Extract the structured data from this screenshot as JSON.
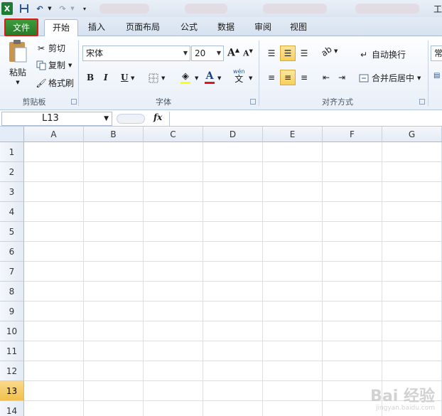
{
  "title": {
    "text": "工"
  },
  "tabs": {
    "file": "文件",
    "items": [
      "开始",
      "插入",
      "页面布局",
      "公式",
      "数据",
      "审阅",
      "视图"
    ]
  },
  "clipboard": {
    "paste": "粘贴",
    "cut": "剪切",
    "copy": "复制",
    "format_painter": "格式刷",
    "label": "剪贴板"
  },
  "font": {
    "name": "宋体",
    "size": "20",
    "bold": "B",
    "italic": "I",
    "underline": "U",
    "font_color_glyph": "A",
    "phonetic": "wén",
    "phonetic_char": "文",
    "label": "字体"
  },
  "alignment": {
    "wrap_text": "自动换行",
    "merge_center": "合并后居中",
    "label": "对齐方式"
  },
  "number": {
    "format_partial": "常"
  },
  "formula_bar": {
    "name_box": "L13",
    "fx": "fx",
    "value": ""
  },
  "grid": {
    "columns": [
      "A",
      "B",
      "C",
      "D",
      "E",
      "F",
      "G"
    ],
    "rows": [
      "1",
      "2",
      "3",
      "4",
      "5",
      "6",
      "7",
      "8",
      "9",
      "10",
      "11",
      "12",
      "13",
      "14"
    ],
    "selected_row": "13"
  },
  "watermark": {
    "main": "Bai 经验",
    "sub": "jingyan.baidu.com"
  },
  "colors": {
    "file_tab": "#2a7a2a",
    "file_highlight": "#e21818",
    "selected_button": "#f7cf5c",
    "selected_row_header": "#f1c04e",
    "font_color_underline": "#e21818",
    "fill_color_underline": "#ffff00"
  }
}
